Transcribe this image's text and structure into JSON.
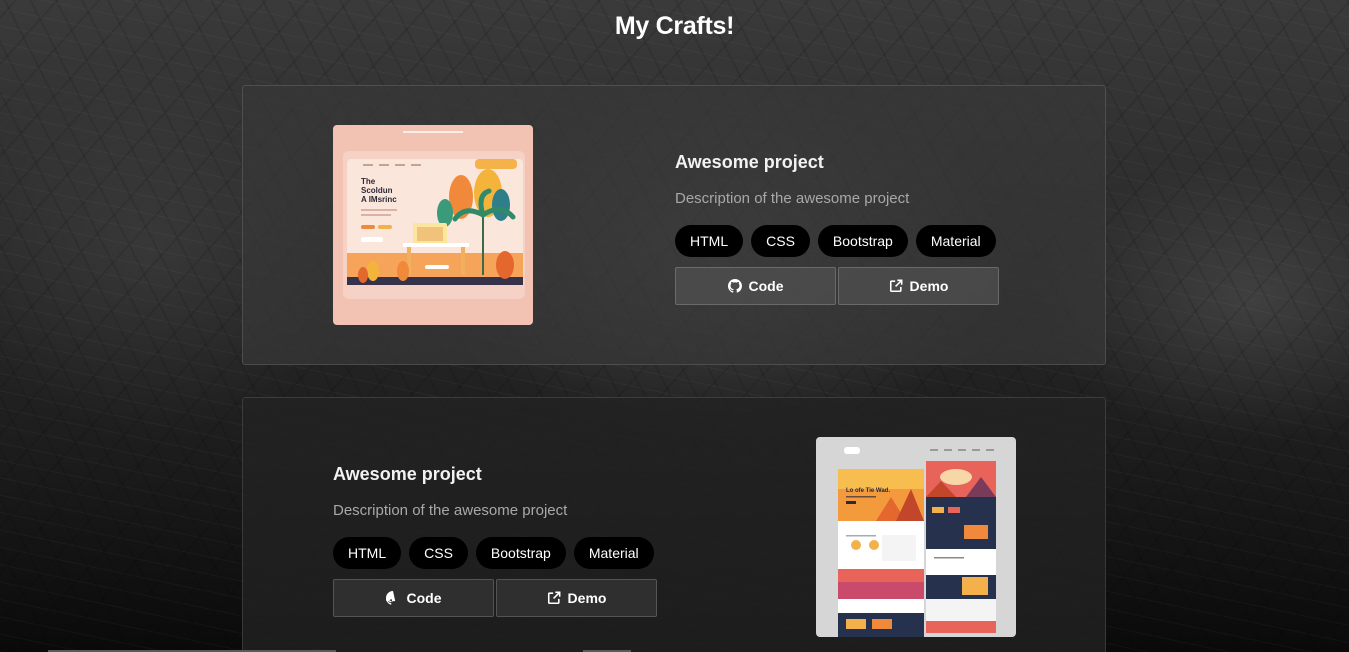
{
  "page": {
    "title": "My Crafts!"
  },
  "projects": [
    {
      "title": "Awesome project",
      "description": "Description of the awesome project",
      "tags": [
        "HTML",
        "CSS",
        "Bootstrap",
        "Material"
      ],
      "code_label": "Code",
      "demo_label": "Demo",
      "thumb_headline": "The Scoldun A IMsrinc"
    },
    {
      "title": "Awesome project",
      "description": "Description of the awesome project",
      "tags": [
        "HTML",
        "CSS",
        "Bootstrap",
        "Material"
      ],
      "code_label": "Code",
      "demo_label": "Demo",
      "thumb_headline": "Lo ofe Tie Wad."
    }
  ],
  "icons": {
    "code": "github-icon",
    "demo": "external-link-icon"
  },
  "colors": {
    "tag_bg": "#000000",
    "accent_orange": "#f59a3c",
    "card_bg": "#373737"
  }
}
